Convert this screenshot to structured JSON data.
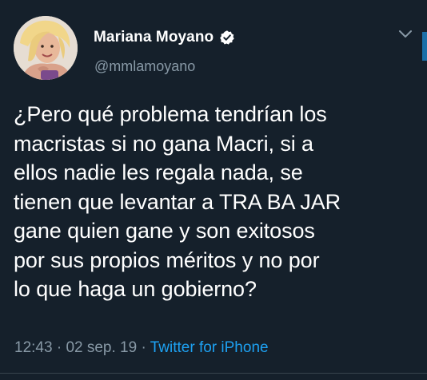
{
  "tweet": {
    "author": {
      "display_name": "Mariana Moyano",
      "handle": "@mmlamoyano",
      "verified": true,
      "avatar_icon": "profile-photo"
    },
    "text_lines": [
      "¿Pero qué problema tendrían los",
      "macristas si no gana Macri, si a",
      "ellos nadie les regala nada, se",
      "tienen que levantar a TRA BA JAR",
      "gane quien gane y son exitosos",
      "por sus propios méritos y no por",
      "lo que haga un gobierno?"
    ],
    "time": "12:43",
    "separator": "·",
    "date": "02 sep. 19",
    "source": "Twitter for iPhone"
  },
  "colors": {
    "background": "#15202b",
    "secondary_text": "#8899a6",
    "link": "#1da1f2",
    "verified_badge": "#ffffff"
  }
}
